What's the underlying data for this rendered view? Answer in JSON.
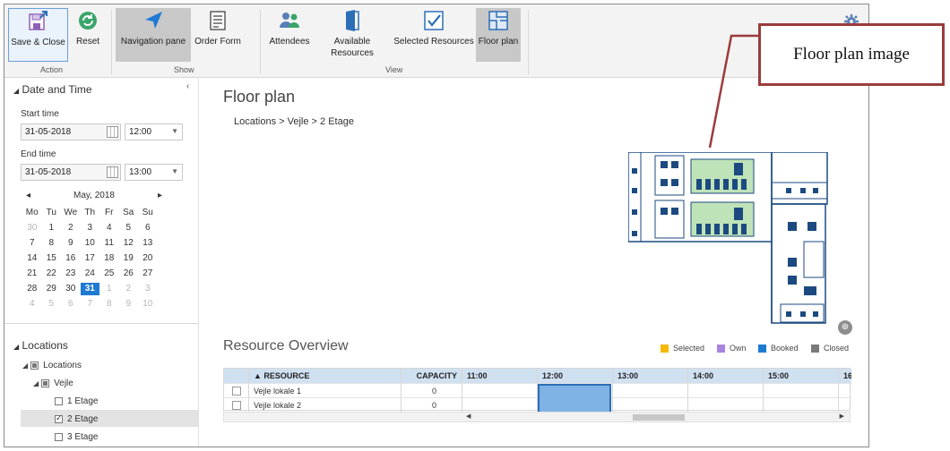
{
  "ribbon": {
    "buttons": {
      "save_close": "Save & Close",
      "reset": "Reset",
      "navigation_pane": "Navigation pane",
      "order_form": "Order Form",
      "attendees": "Attendees",
      "available_resources": "Available Resources",
      "selected_resources": "Selected Resources",
      "floor_plan": "Floor plan"
    },
    "groups": {
      "action": "Action",
      "show": "Show",
      "view": "View"
    }
  },
  "left": {
    "date_time_title": "Date and Time",
    "start_label": "Start time",
    "start_date": "31-05-2018",
    "start_time": "12:00",
    "end_label": "End time",
    "end_date": "31-05-2018",
    "end_time": "13:00",
    "calendar": {
      "month": "May, 2018",
      "weekdays": [
        "Mo",
        "Tu",
        "We",
        "Th",
        "Fr",
        "Sa",
        "Su"
      ],
      "days": [
        "30",
        "1",
        "2",
        "3",
        "4",
        "5",
        "6",
        "7",
        "8",
        "9",
        "10",
        "11",
        "12",
        "13",
        "14",
        "15",
        "16",
        "17",
        "18",
        "19",
        "20",
        "21",
        "22",
        "23",
        "24",
        "25",
        "26",
        "27",
        "28",
        "29",
        "30",
        "31",
        "1",
        "2",
        "3",
        "4",
        "5",
        "6",
        "7",
        "8",
        "9",
        "10"
      ],
      "dim": [
        0,
        32,
        33,
        34,
        35,
        36,
        37,
        38,
        39,
        40,
        41
      ],
      "selected": 31
    },
    "locations_title": "Locations",
    "tree": {
      "root": "Locations",
      "vejle": "Vejle",
      "etage1": "1 Etage",
      "etage2": "2 Etage",
      "etage3": "3 Etage"
    }
  },
  "main": {
    "floor_plan_title": "Floor plan",
    "breadcrumb": "Locations > Vejle > 2 Etage",
    "resource_overview_title": "Resource Overview",
    "legend": {
      "selected": "Selected",
      "own": "Own",
      "booked": "Booked",
      "closed": "Closed"
    },
    "legend_colors": {
      "selected": "#f5b800",
      "own": "#a785de",
      "booked": "#1e7ad2",
      "closed": "#7a7a7a"
    },
    "grid": {
      "resource_header": "▲ RESOURCE",
      "capacity_header": "CAPACITY",
      "times": [
        "11:00",
        "12:00",
        "13:00",
        "14:00",
        "15:00",
        "16"
      ],
      "rows": [
        {
          "name": "Vejle lokale 1",
          "capacity": "0"
        },
        {
          "name": "Vejle lokale 2",
          "capacity": "0"
        }
      ]
    }
  },
  "annotation": {
    "callout": "Floor plan image"
  }
}
